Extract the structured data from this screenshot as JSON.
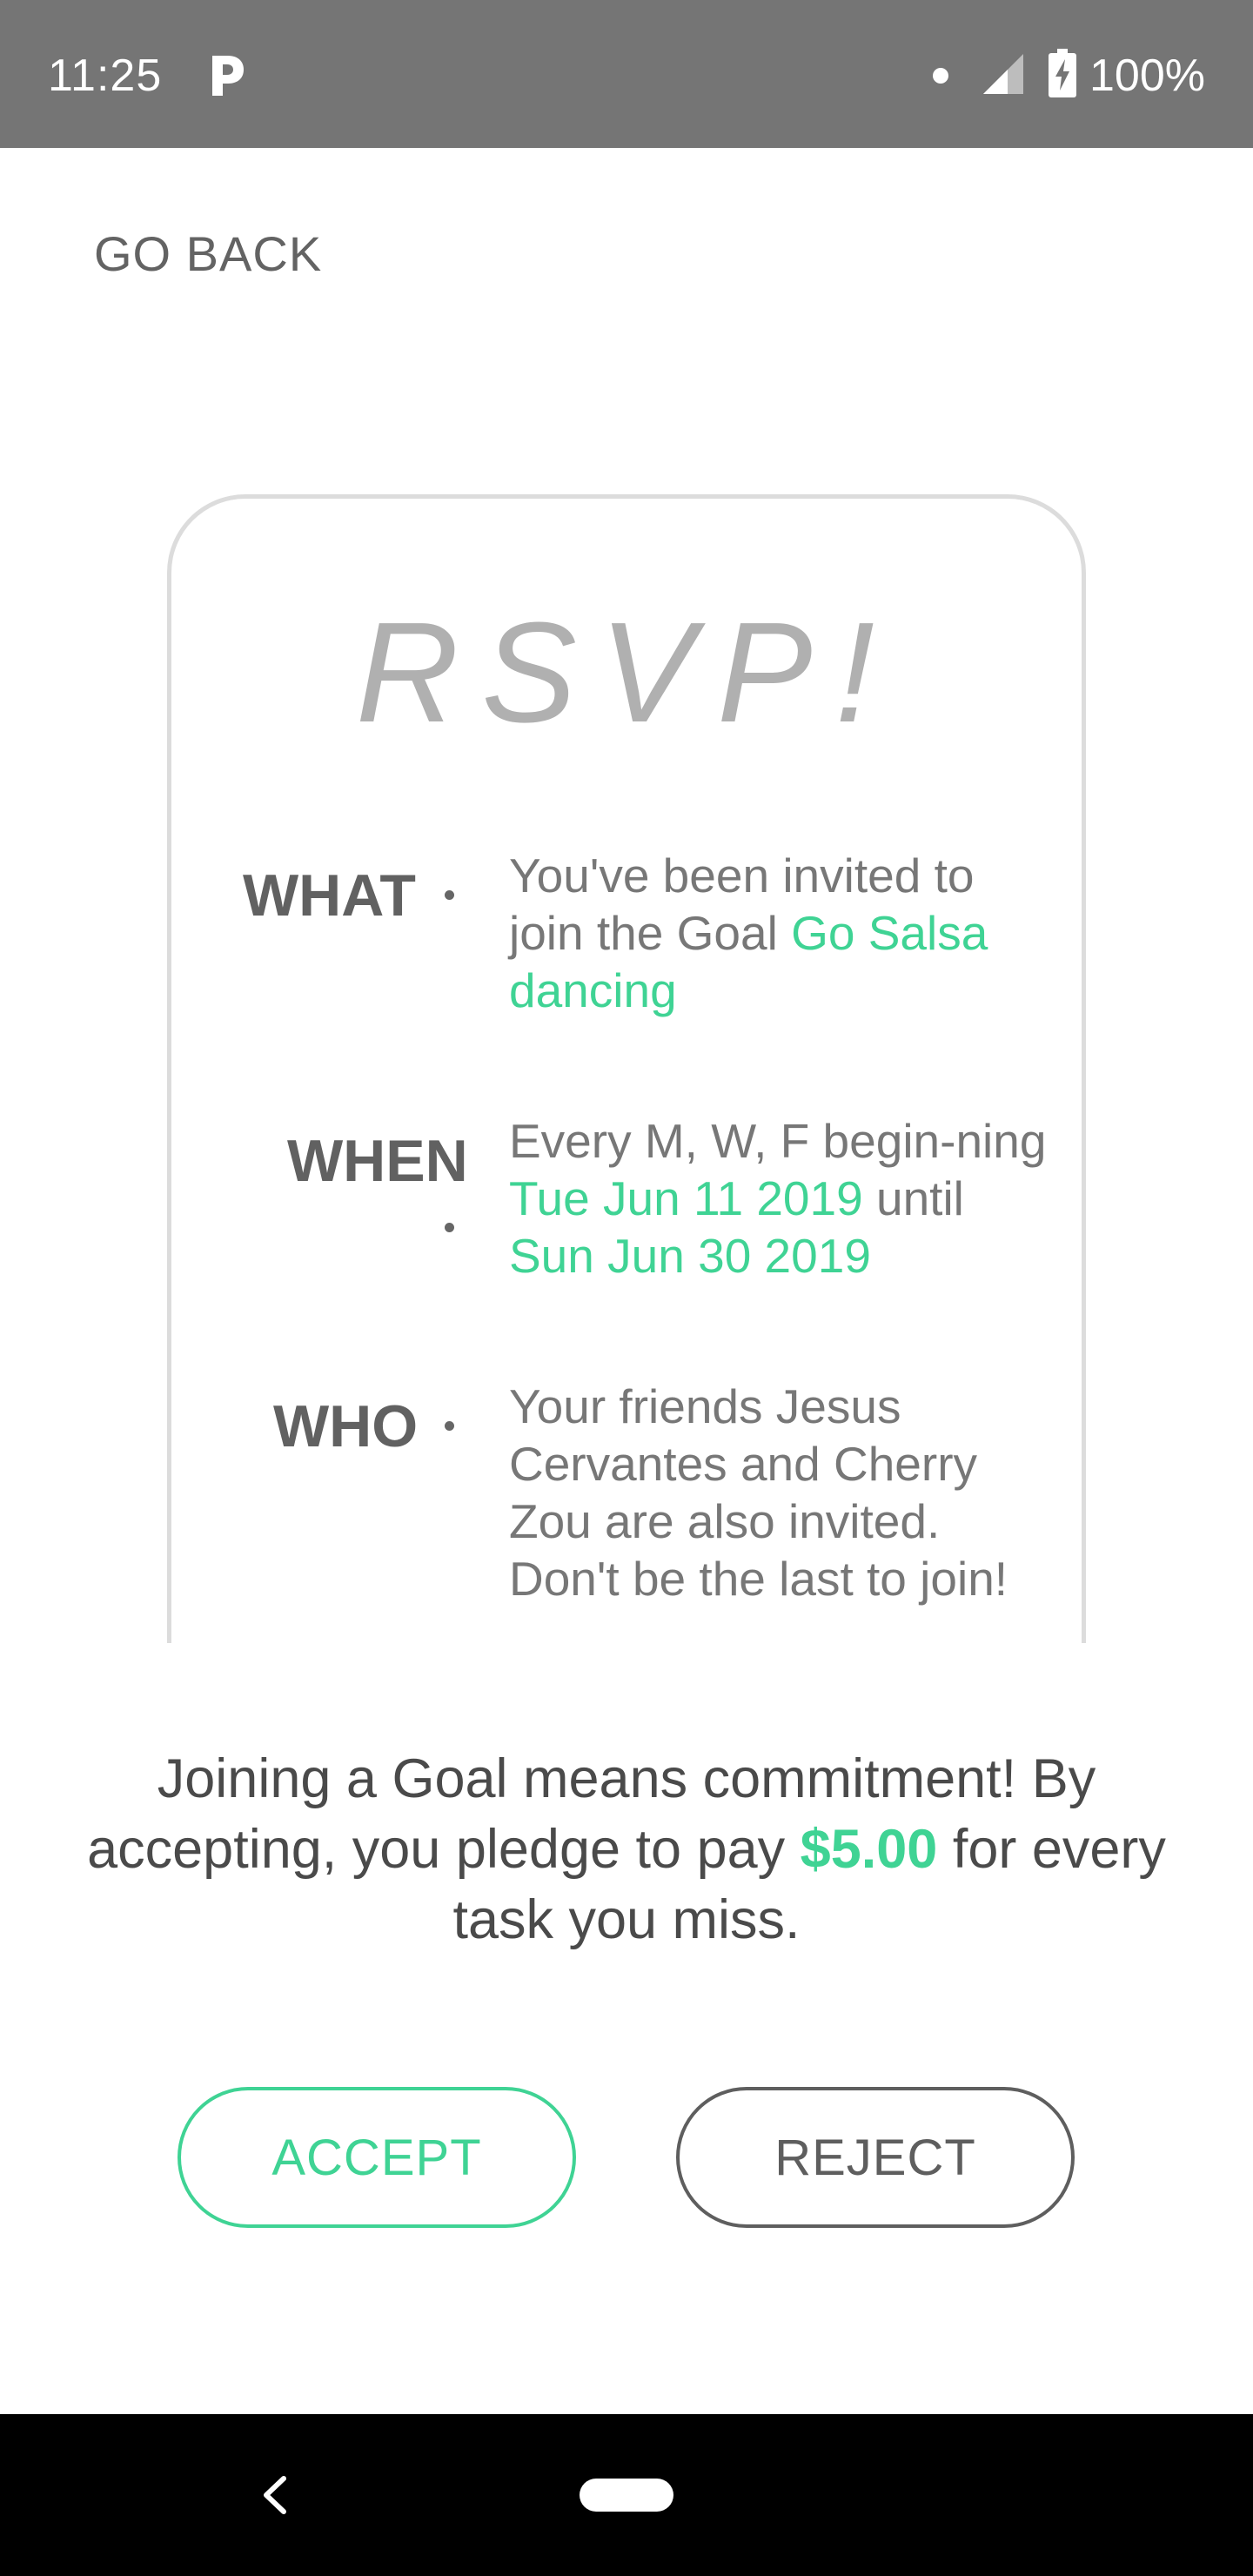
{
  "status_bar": {
    "time": "11:25",
    "battery_pct": "100%",
    "icons": [
      "parking-app-icon",
      "notification-dot-icon",
      "cell-signal-icon",
      "battery-charging-icon"
    ]
  },
  "nav": {
    "go_back_label": "GO BACK"
  },
  "card": {
    "title": "RSVP!",
    "what": {
      "label": "WHAT",
      "prefix": "You've been invited to join the Goal ",
      "goal_name": "Go Salsa dancing"
    },
    "when": {
      "label": "WHEN",
      "prefix": "Every M, W, F begin-ning ",
      "start_date": "Tue Jun 11 2019",
      "middle": " until ",
      "end_date": "Sun Jun 30 2019"
    },
    "who": {
      "label": "WHO",
      "text": "Your friends Jesus Cervantes and Cherry Zou are also invited. Don't be the last to join!"
    }
  },
  "pledge": {
    "prefix": "Joining a Goal means commitment! By accepting, you pledge to pay ",
    "amount": "$5.00",
    "suffix": " for every task you miss."
  },
  "buttons": {
    "accept_label": "ACCEPT",
    "reject_label": "REJECT"
  },
  "colors": {
    "accent_green": "#3fd394",
    "status_bar_bg": "#757575",
    "text_gray": "#616161"
  }
}
